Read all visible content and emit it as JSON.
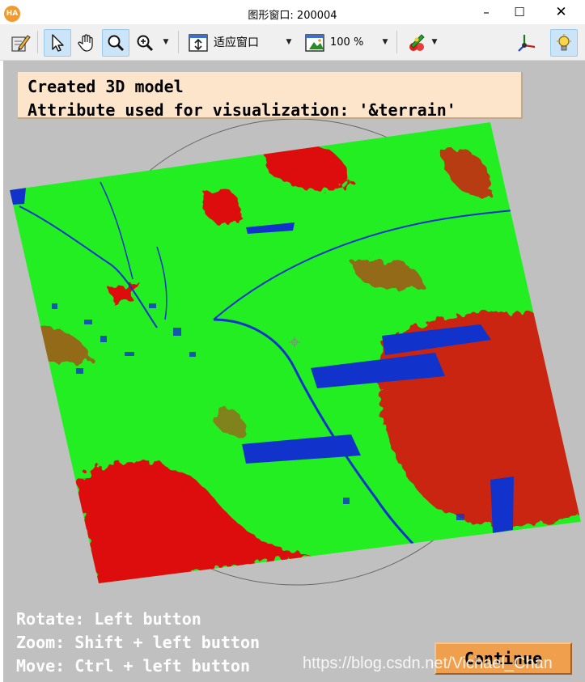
{
  "window": {
    "logo_text": "HA",
    "title": "图形窗口: 200004",
    "minimize_glyph": "–",
    "maximize_glyph": "☐",
    "close_glyph": "✕"
  },
  "toolbar": {
    "items": [
      {
        "name": "edit-properties-icon"
      },
      {
        "name": "pointer-icon"
      },
      {
        "name": "hand-pan-icon"
      },
      {
        "name": "magnifier-icon"
      },
      {
        "name": "zoom-in-icon"
      },
      {
        "name": "fit-window-icon"
      },
      {
        "name": "zoom-percent-icon"
      },
      {
        "name": "color-palette-icon"
      },
      {
        "name": "3d-axes-icon"
      },
      {
        "name": "lightbulb-icon"
      }
    ],
    "fit_label": "适应窗口",
    "zoom_label": "100 %"
  },
  "message": {
    "line1": "Created 3D model",
    "line2": "Attribute used for visualization: '&terrain'"
  },
  "hints": {
    "rotate": "Rotate: Left button",
    "zoom": "Zoom: Shift + left button",
    "move": "Move: Ctrl + left button"
  },
  "continue_label": "Continue",
  "watermark": "https://blog.csdn.net/Vichael_Chan",
  "colors": {
    "background": "#c0c0c0",
    "terrain_flat": "#22ee22",
    "terrain_steep": "#dd1111",
    "terrain_water": "#1133cc",
    "message_bg": "#fde5cc",
    "button_bg": "#f0a04c"
  }
}
